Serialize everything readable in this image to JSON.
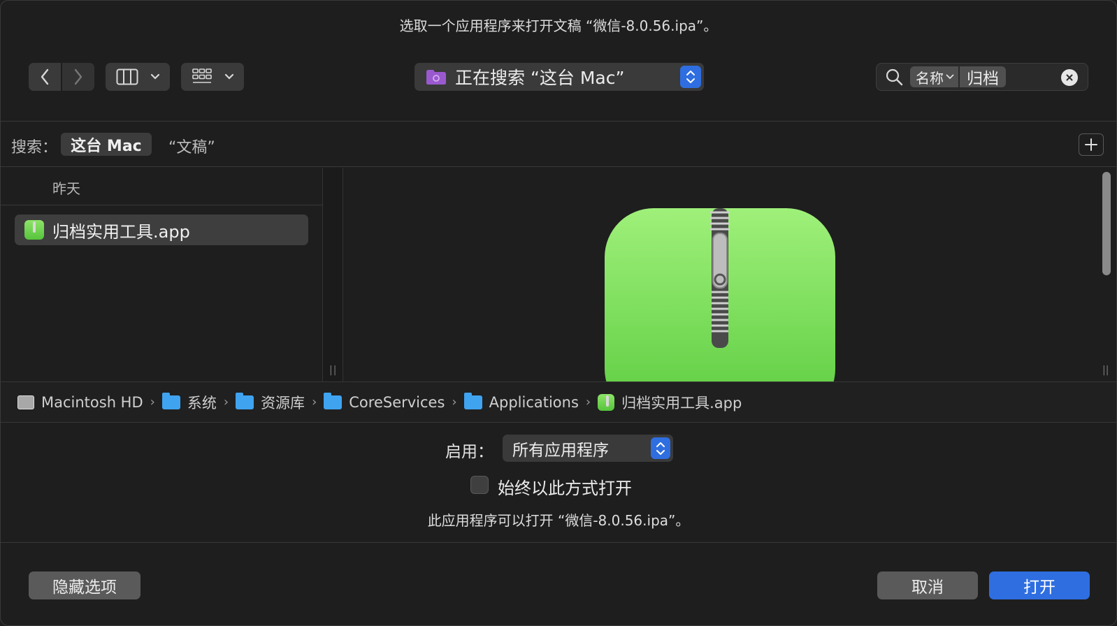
{
  "dialog": {
    "title": "选取一个应用程序来打开文稿 “微信-8.0.56.ipa”。"
  },
  "toolbar": {
    "back_icon": "chevron-left-icon",
    "forward_icon": "chevron-right-icon",
    "view_icon": "column-view-icon",
    "group_icon": "grid-view-icon",
    "location_label": "正在搜索 “这台 Mac”",
    "search": {
      "token_field": "名称",
      "token_value": "归档"
    }
  },
  "scope": {
    "label": "搜索：",
    "this_mac": "这台 Mac",
    "documents": "“文稿”"
  },
  "results": {
    "group_header": "昨天",
    "items": [
      {
        "name": "归档实用工具.app",
        "selected": true
      }
    ]
  },
  "path_bar": {
    "items": [
      "Macintosh HD",
      "系统",
      "资源库",
      "CoreServices",
      "Applications",
      "归档实用工具.app"
    ]
  },
  "options": {
    "enable_label": "启用：",
    "enable_value": "所有应用程序",
    "always_open_label": "始终以此方式打开",
    "always_open_checked": false,
    "info_text": "此应用程序可以打开 “微信-8.0.56.ipa”。"
  },
  "buttons": {
    "hide_options": "隐藏选项",
    "cancel": "取消",
    "open": "打开"
  },
  "colors": {
    "accent": "#2f6ee0",
    "app_icon_green": "#6fd44c",
    "folder_blue": "#3fa3f0"
  }
}
